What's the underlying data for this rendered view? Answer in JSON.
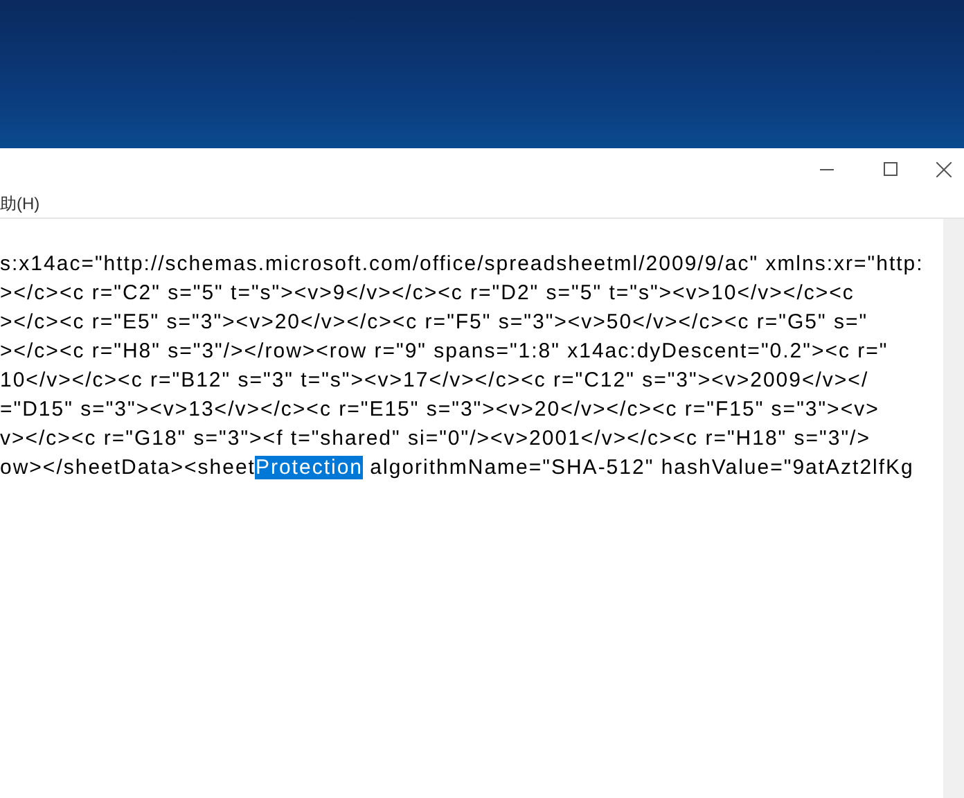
{
  "menu_bar": {
    "items": [
      "助(H)"
    ]
  },
  "editor": {
    "lines": [
      [
        {
          "text": "s:x14ac=\"http://schemas.microsoft.com/office/spreadsheetml/2009/9/ac\" xmlns:xr=\"http:",
          "selected": false
        }
      ],
      [
        {
          "text": "></c><c r=\"C2\" s=\"5\" t=\"s\"><v>9</v></c><c r=\"D2\" s=\"5\" t=\"s\"><v>10</v></c><c",
          "selected": false
        }
      ],
      [
        {
          "text": "></c><c r=\"E5\" s=\"3\"><v>20</v></c><c r=\"F5\" s=\"3\"><v>50</v></c><c r=\"G5\" s=\"",
          "selected": false
        }
      ],
      [
        {
          "text": "></c><c r=\"H8\" s=\"3\"/></row><row r=\"9\" spans=\"1:8\" x14ac:dyDescent=\"0.2\"><c r=\"",
          "selected": false
        }
      ],
      [
        {
          "text": "10</v></c><c r=\"B12\" s=\"3\" t=\"s\"><v>17</v></c><c r=\"C12\" s=\"3\"><v>2009</v></",
          "selected": false
        }
      ],
      [
        {
          "text": "=\"D15\" s=\"3\"><v>13</v></c><c r=\"E15\" s=\"3\"><v>20</v></c><c r=\"F15\" s=\"3\"><v>",
          "selected": false
        }
      ],
      [
        {
          "text": "v></c><c r=\"G18\" s=\"3\"><f t=\"shared\" si=\"0\"/><v>2001</v></c><c r=\"H18\" s=\"3\"/>",
          "selected": false
        }
      ],
      [
        {
          "text": "ow></sheetData><sheet",
          "selected": false
        },
        {
          "text": "Protection",
          "selected": true
        },
        {
          "text": " algorithmName=\"SHA-512\" hashValue=\"9atAzt2lfKg",
          "selected": false
        }
      ]
    ]
  }
}
